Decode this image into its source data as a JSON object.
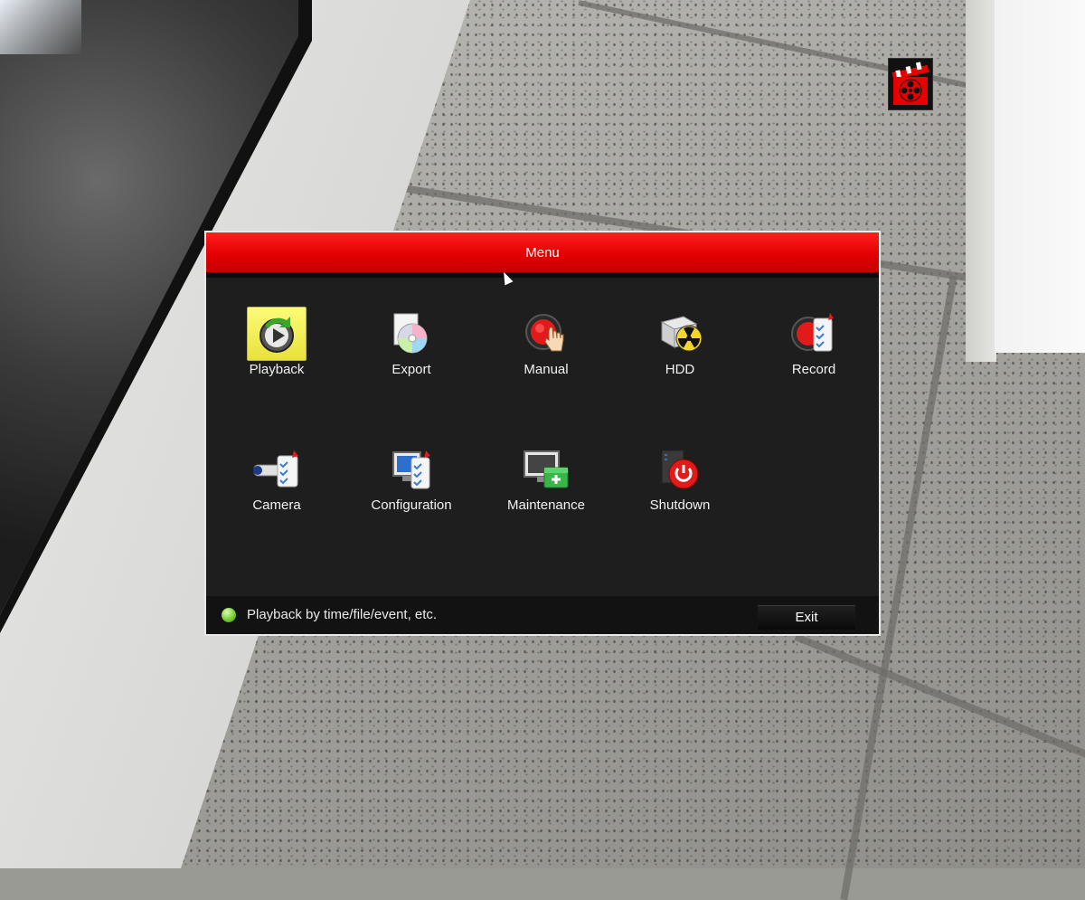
{
  "menu": {
    "title": "Menu",
    "items": [
      {
        "label": "Playback",
        "icon": "playback-icon",
        "selected": true
      },
      {
        "label": "Export",
        "icon": "export-disc-icon",
        "selected": false
      },
      {
        "label": "Manual",
        "icon": "manual-hand-icon",
        "selected": false
      },
      {
        "label": "HDD",
        "icon": "hdd-icon",
        "selected": false
      },
      {
        "label": "Record",
        "icon": "record-icon",
        "selected": false
      },
      {
        "label": "Camera",
        "icon": "camera-icon",
        "selected": false
      },
      {
        "label": "Configuration",
        "icon": "configuration-icon",
        "selected": false
      },
      {
        "label": "Maintenance",
        "icon": "maintenance-icon",
        "selected": false
      },
      {
        "label": "Shutdown",
        "icon": "shutdown-icon",
        "selected": false
      }
    ],
    "hint": "Playback by time/file/event, etc.",
    "exit_label": "Exit"
  },
  "colors": {
    "titlebar": "#e30000",
    "panel": "#1e1e1e",
    "selected_highlight": "#f4ef5a",
    "hint_dot": "#6ec82a"
  },
  "status_icon": "recording-film-icon"
}
